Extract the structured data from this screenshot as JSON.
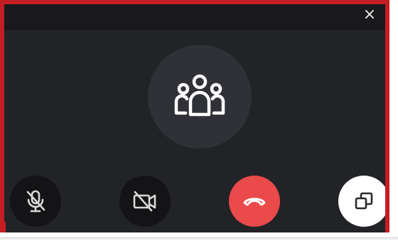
{
  "window": {
    "type": "video-call-minimized",
    "accent_border": "#c41e24",
    "background": "#222326"
  },
  "header": {
    "close_icon": "close-icon",
    "close_glyph": "×"
  },
  "participant": {
    "avatar_icon": "group-people-icon",
    "avatar_background": "#2f3136"
  },
  "controls": [
    {
      "name": "mute-microphone-button",
      "icon": "microphone-off-icon",
      "state": "muted"
    },
    {
      "name": "toggle-camera-button",
      "icon": "camera-off-icon",
      "state": "off"
    },
    {
      "name": "end-call-button",
      "icon": "phone-hangup-icon",
      "color": "#ea4a4a"
    },
    {
      "name": "popout-window-button",
      "icon": "restore-window-icon",
      "color": "#ffffff"
    }
  ]
}
